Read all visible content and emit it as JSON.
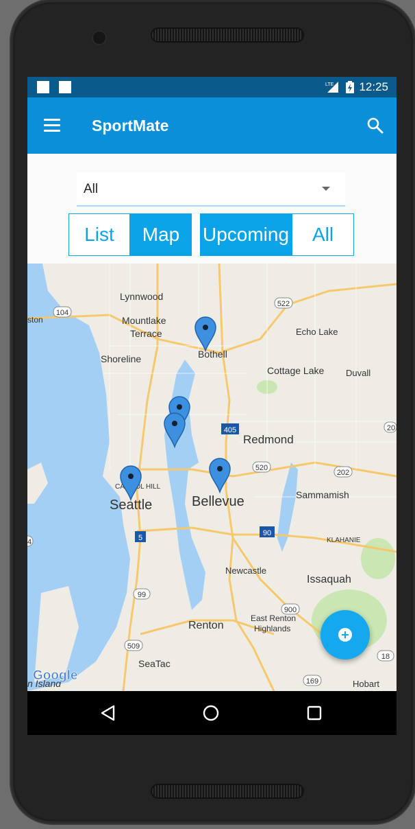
{
  "status_bar": {
    "network": "LTE",
    "time": "12:25"
  },
  "app_bar": {
    "title": "SportMate"
  },
  "filter": {
    "selected": "All"
  },
  "view_toggle": {
    "list_label": "List",
    "map_label": "Map",
    "selected": "Map"
  },
  "time_toggle": {
    "upcoming_label": "Upcoming",
    "all_label": "All",
    "selected": "Upcoming"
  },
  "map": {
    "labels": {
      "lynnwood": "Lynnwood",
      "mountlake_terrace_1": "Mountlake",
      "mountlake_terrace_2": "Terrace",
      "shoreline": "Shoreline",
      "bothell": "Bothell",
      "echo_lake": "Echo Lake",
      "cottage_lake": "Cottage Lake",
      "duvall": "Duvall",
      "redmond": "Redmond",
      "sammamish": "Sammamish",
      "capitol_hill": "CAPITOL HILL",
      "seattle": "Seattle",
      "bellevue": "Bellevue",
      "klahanie": "KLAHANIE",
      "newcastle": "Newcastle",
      "issaquah": "Issaquah",
      "east_renton_1": "East Renton",
      "east_renton_2": "Highlands",
      "renton": "Renton",
      "seatac": "SeaTac",
      "hobart": "Hobart",
      "island_partial": "n Island",
      "ston_partial": "ston",
      "google": "Google"
    },
    "route_shields": [
      "104",
      "522",
      "405",
      "520",
      "202",
      "90",
      "5",
      "99",
      "900",
      "509",
      "169",
      "18",
      "20",
      "4"
    ],
    "marker_count": 5
  },
  "fab": {
    "icon": "add-icon"
  },
  "colors": {
    "primary": "#0a8fd8",
    "status_bar": "#0a5b8c",
    "accent": "#16a8ee",
    "water": "#a4cff5"
  }
}
